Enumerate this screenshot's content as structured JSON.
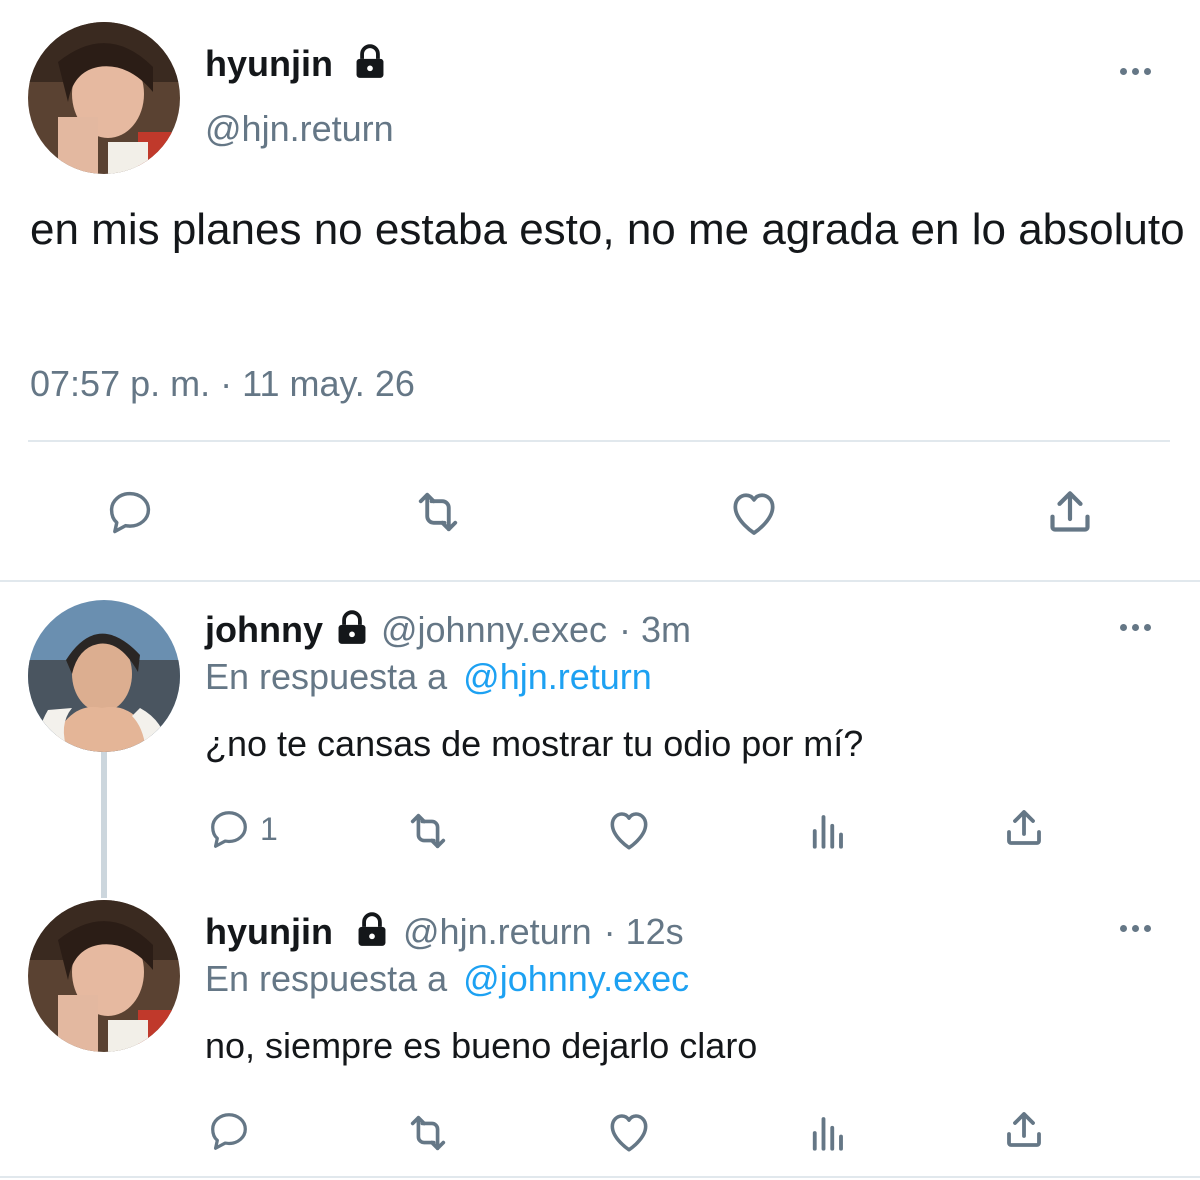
{
  "main_tweet": {
    "display_name": "hyunjin",
    "handle": "@hjn.return",
    "text": "en mis planes no estaba esto, no me agrada en lo absoluto",
    "timestamp": "07:57 p. m. · 11 may. 26",
    "protected_icon": "lock-icon",
    "actions": [
      "reply-icon",
      "retweet-icon",
      "like-icon",
      "share-icon"
    ]
  },
  "replies": [
    {
      "display_name": "johnny",
      "handle": "@johnny.exec",
      "time": "· 3m",
      "reply_prefix": "En respuesta a",
      "reply_to": "@hjn.return",
      "text": "¿no te cansas de mostrar tu odio por mí?",
      "reply_count": "1"
    },
    {
      "display_name": "hyunjin",
      "handle": "@hjn.return",
      "time": "· 12s",
      "reply_prefix": "En respuesta a",
      "reply_to": "@johnny.exec",
      "text": "no, siempre es bueno dejarlo claro",
      "reply_count": ""
    }
  ],
  "colors": {
    "text": "#14171a",
    "secondary": "#657786",
    "link": "#1da1f2",
    "divider": "#e1e8ed"
  }
}
